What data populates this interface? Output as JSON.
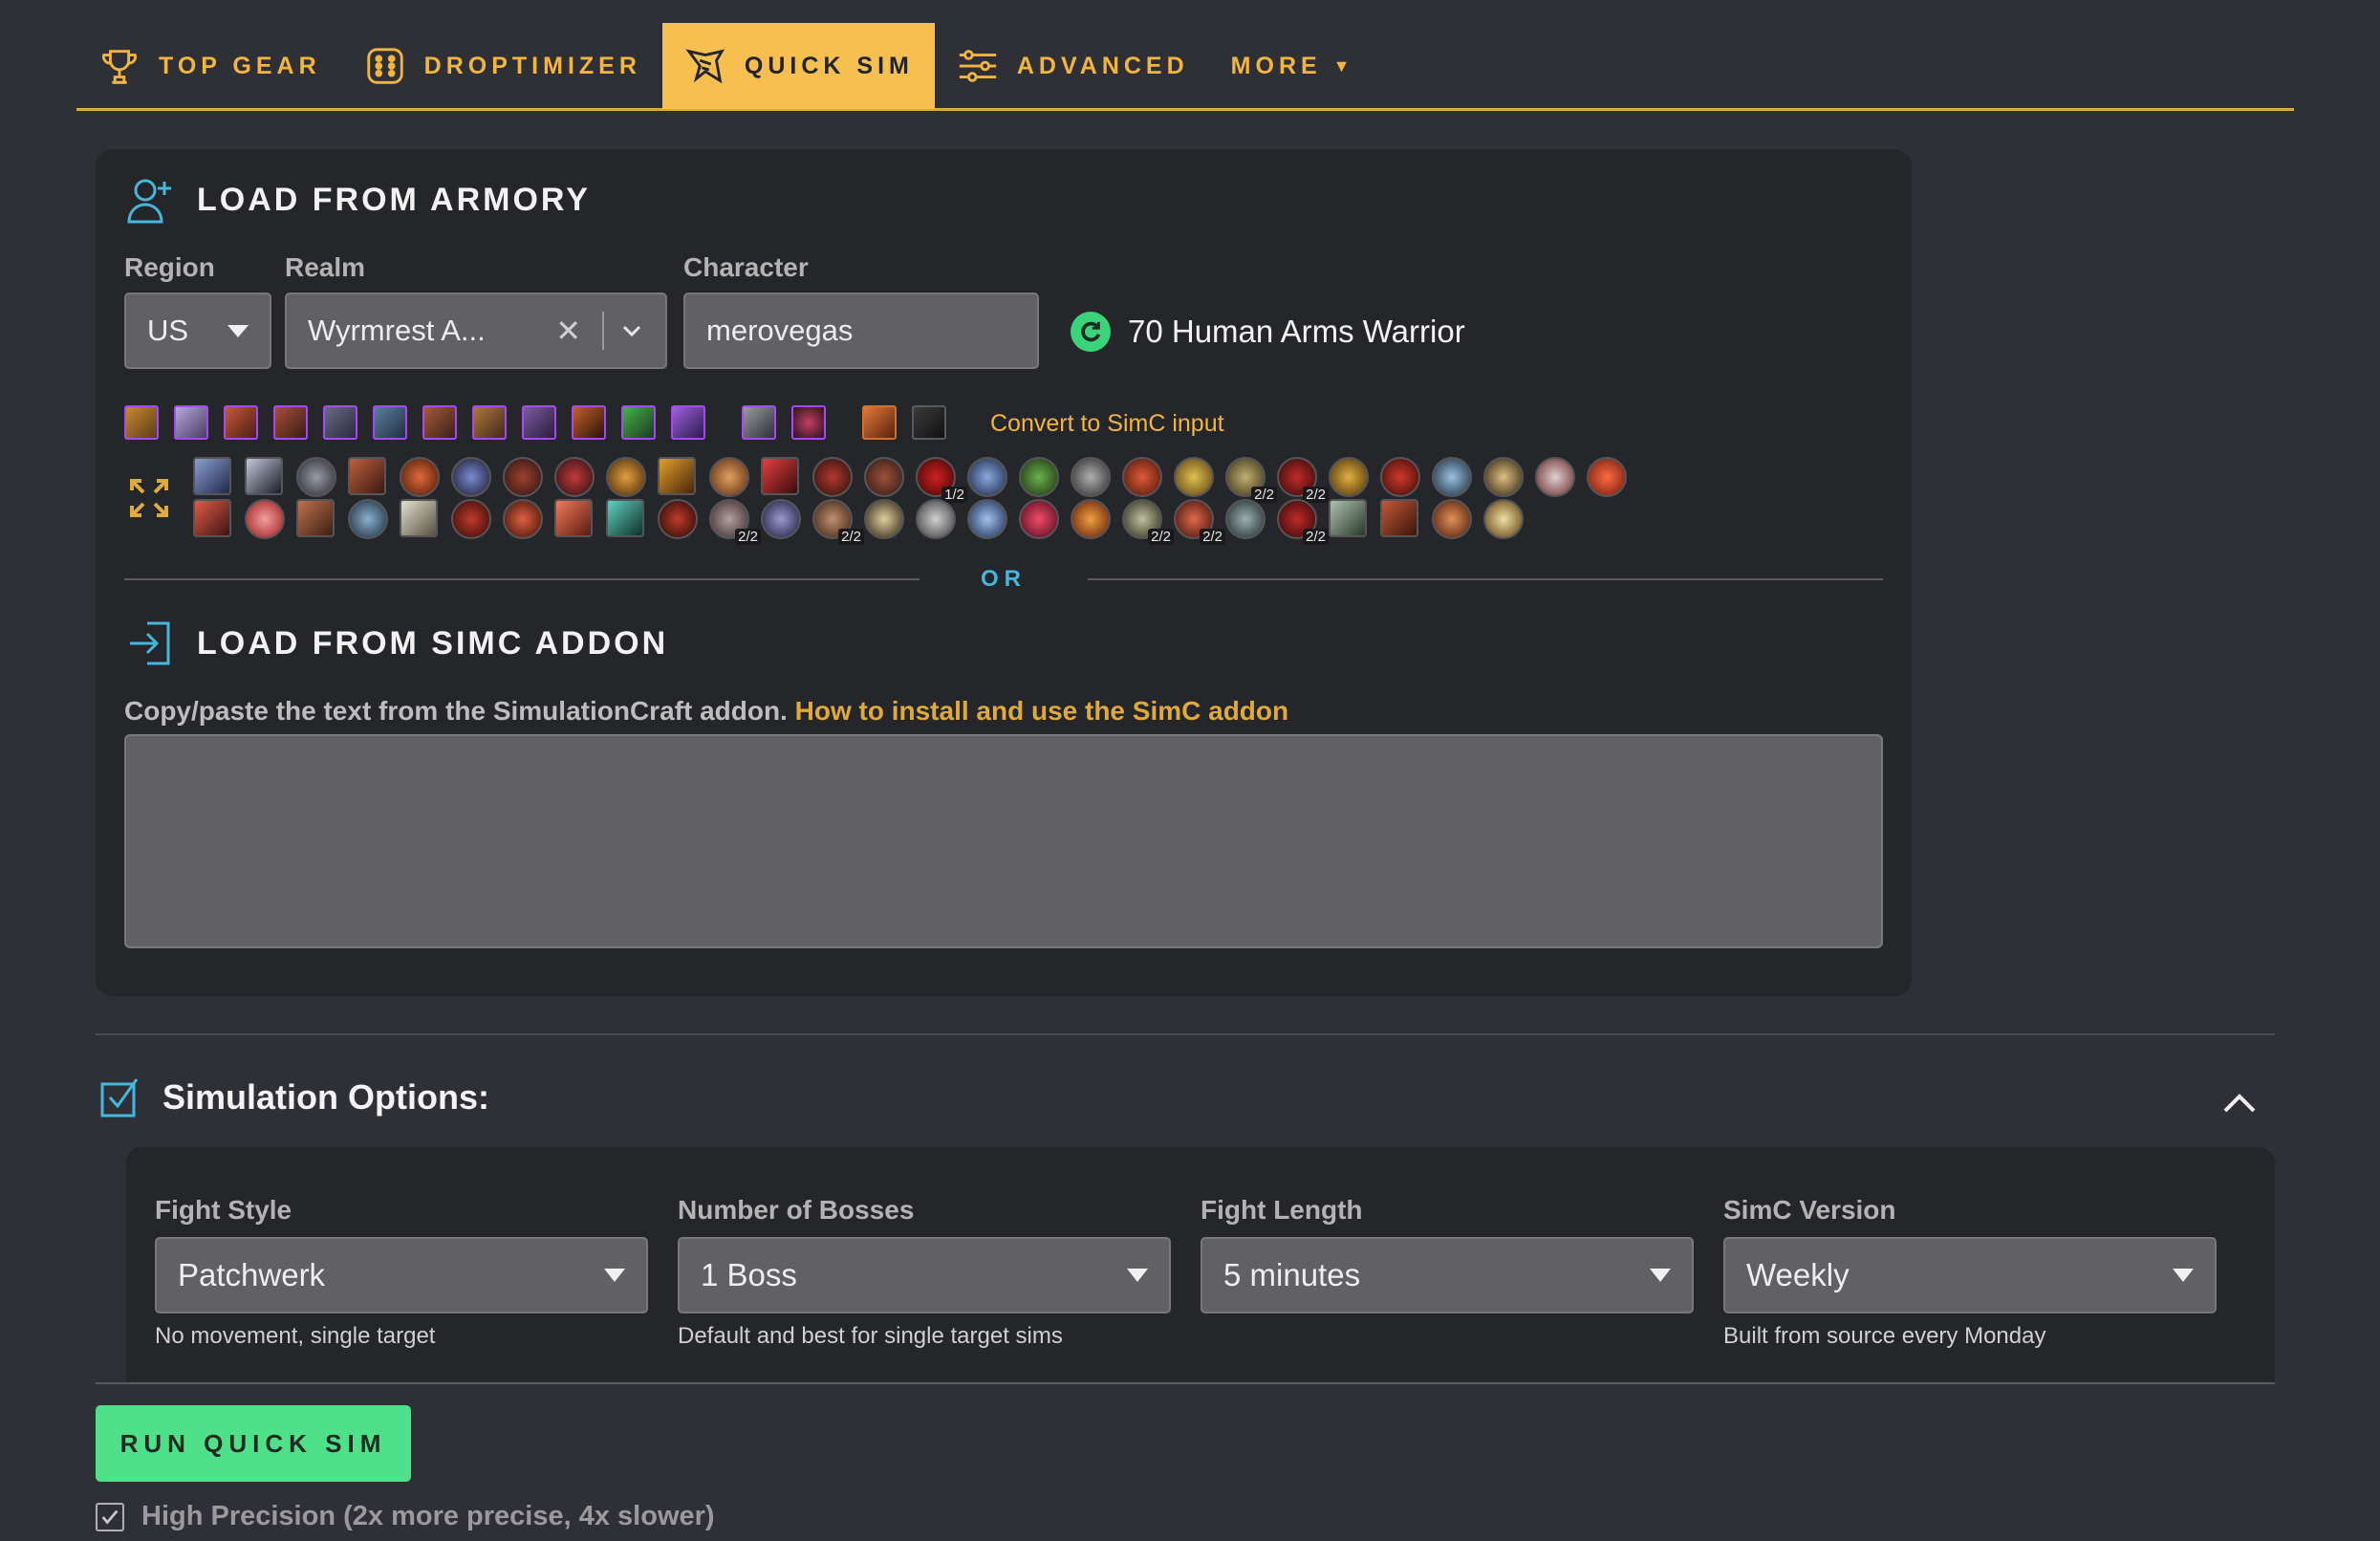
{
  "nav": {
    "tabs": [
      {
        "label": "TOP GEAR",
        "icon": "trophy-icon"
      },
      {
        "label": "DROPTIMIZER",
        "icon": "dice-icon"
      },
      {
        "label": "QUICK SIM",
        "icon": "quick-sim-icon",
        "active": true
      },
      {
        "label": "ADVANCED",
        "icon": "sliders-icon"
      },
      {
        "label": "MORE",
        "icon": "caret-down-icon"
      }
    ]
  },
  "armory": {
    "title": "LOAD FROM ARMORY",
    "region_label": "Region",
    "region_value": "US",
    "realm_label": "Realm",
    "realm_value": "Wyrmrest A...",
    "clear_symbol": "✕",
    "character_label": "Character",
    "character_value": "merovegas",
    "character_summary": "70 Human Arms Warrior",
    "convert_link": "Convert to SimC input",
    "talent_ranks": [
      "1/2",
      "2/2",
      "2/2",
      "2/2",
      "2/2",
      "2/2",
      "2/2",
      "2/2",
      "2/2"
    ]
  },
  "divider": {
    "or_text": "OR"
  },
  "simc": {
    "title": "LOAD FROM SIMC ADDON",
    "description": "Copy/paste the text from the SimulationCraft addon.",
    "help_link": "How to install and use the SimC addon",
    "textarea_value": ""
  },
  "sim_options": {
    "title": "Simulation Options:",
    "fields": [
      {
        "label": "Fight Style",
        "value": "Patchwerk",
        "hint": "No movement, single target"
      },
      {
        "label": "Number of Bosses",
        "value": "1 Boss",
        "hint": "Default and best for single target sims"
      },
      {
        "label": "Fight Length",
        "value": "5 minutes",
        "hint": ""
      },
      {
        "label": "SimC Version",
        "value": "Weekly",
        "hint": "Built from source every Monday"
      }
    ]
  },
  "run_button": "RUN QUICK SIM",
  "high_precision": {
    "label": "High Precision (2x more precise, 4x slower)",
    "checked": true
  },
  "colors": {
    "accent": "#f7bf4f",
    "background": "#2f3036",
    "card": "#25262a",
    "link_blue": "#45b7dd",
    "run_green": "#4fe08a",
    "epic_border": "#a44af0"
  }
}
